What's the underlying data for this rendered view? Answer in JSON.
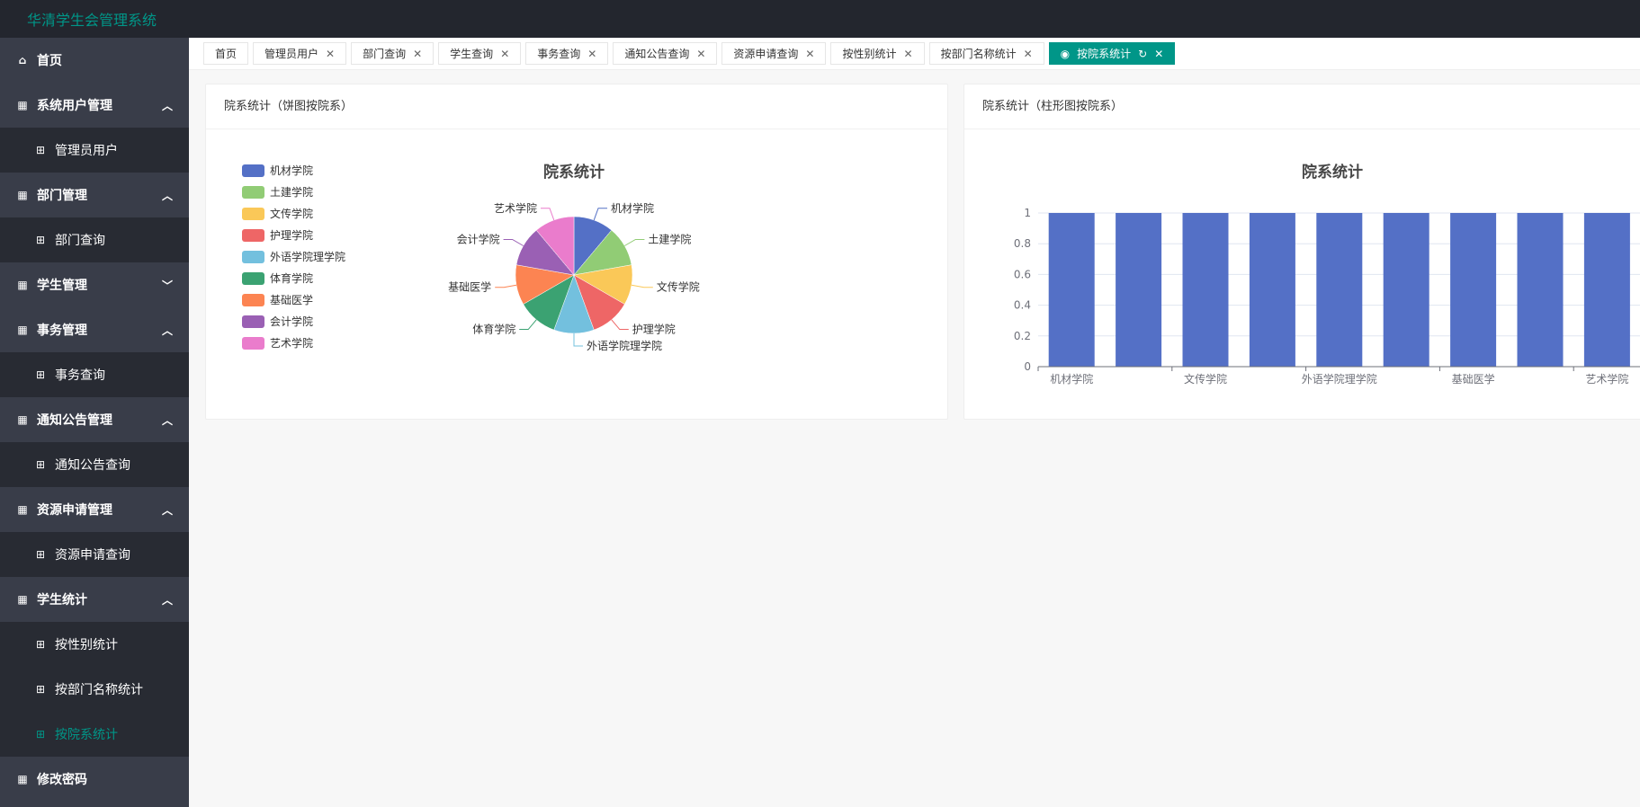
{
  "app": {
    "title": "华清学生会管理系统"
  },
  "sidebar": {
    "items": [
      {
        "label": "首页",
        "icon": "home-icon",
        "level": "top"
      },
      {
        "label": "系统用户管理",
        "icon": "grid-icon",
        "level": "top",
        "chevron": "up"
      },
      {
        "label": "管理员用户",
        "icon": "apps-icon",
        "level": "sub"
      },
      {
        "label": "部门管理",
        "icon": "grid-icon",
        "level": "top",
        "chevron": "up"
      },
      {
        "label": "部门查询",
        "icon": "apps-icon",
        "level": "sub"
      },
      {
        "label": "学生管理",
        "icon": "grid-icon",
        "level": "top",
        "chevron": "down"
      },
      {
        "label": "事务管理",
        "icon": "grid-icon",
        "level": "top",
        "chevron": "up"
      },
      {
        "label": "事务查询",
        "icon": "apps-icon",
        "level": "sub"
      },
      {
        "label": "通知公告管理",
        "icon": "grid-icon",
        "level": "top",
        "chevron": "up"
      },
      {
        "label": "通知公告查询",
        "icon": "apps-icon",
        "level": "sub"
      },
      {
        "label": "资源申请管理",
        "icon": "grid-icon",
        "level": "top",
        "chevron": "up"
      },
      {
        "label": "资源申请查询",
        "icon": "apps-icon",
        "level": "sub"
      },
      {
        "label": "学生统计",
        "icon": "grid-icon",
        "level": "top",
        "chevron": "up"
      },
      {
        "label": "按性别统计",
        "icon": "apps-icon",
        "level": "sub"
      },
      {
        "label": "按部门名称统计",
        "icon": "apps-icon",
        "level": "sub"
      },
      {
        "label": "按院系统计",
        "icon": "apps-icon",
        "level": "sub",
        "active": true
      },
      {
        "label": "修改密码",
        "icon": "grid-icon",
        "level": "top"
      }
    ]
  },
  "tabs": [
    {
      "label": "首页",
      "closable": false
    },
    {
      "label": "管理员用户",
      "closable": true
    },
    {
      "label": "部门查询",
      "closable": true
    },
    {
      "label": "学生查询",
      "closable": true
    },
    {
      "label": "事务查询",
      "closable": true
    },
    {
      "label": "通知公告查询",
      "closable": true
    },
    {
      "label": "资源申请查询",
      "closable": true
    },
    {
      "label": "按性别统计",
      "closable": true
    },
    {
      "label": "按部门名称统计",
      "closable": true
    },
    {
      "label": "按院系统计",
      "closable": true,
      "active": true
    }
  ],
  "colors": {
    "accent": "#009688",
    "header": "#23262e",
    "sidebar": "#393d49"
  },
  "pie_card": {
    "header": "院系统计（饼图按院系）"
  },
  "bar_card": {
    "header": "院系统计（柱形图按院系）"
  },
  "chart_data": [
    {
      "type": "pie",
      "title": "院系统计",
      "legend_placement": "left",
      "categories": [
        "机材学院",
        "土建学院",
        "文传学院",
        "护理学院",
        "外语学院理学院",
        "体育学院",
        "基础医学",
        "会计学院",
        "艺术学院"
      ],
      "values": [
        1,
        1,
        1,
        1,
        1,
        1,
        1,
        1,
        1
      ],
      "colors": [
        "#5470c6",
        "#91cc75",
        "#fac858",
        "#ee6666",
        "#73c0de",
        "#3ba272",
        "#fc8452",
        "#9a60b4",
        "#ea7ccc"
      ]
    },
    {
      "type": "bar",
      "title": "院系统计",
      "categories": [
        "机材学院",
        "土建学院",
        "文传学院",
        "护理学院",
        "外语学院理学院",
        "体育学院",
        "基础医学",
        "会计学院",
        "艺术学院"
      ],
      "shown_tick_labels": [
        "机材学院",
        "文传学院",
        "外语学院理学院",
        "基础医学",
        "艺术学院"
      ],
      "values": [
        1,
        1,
        1,
        1,
        1,
        1,
        1,
        1,
        1
      ],
      "ylim": [
        0,
        1
      ],
      "yticks": [
        "0",
        "0.2",
        "0.4",
        "0.6",
        "0.8",
        "1"
      ],
      "grid": true,
      "color": "#5470c6"
    }
  ]
}
